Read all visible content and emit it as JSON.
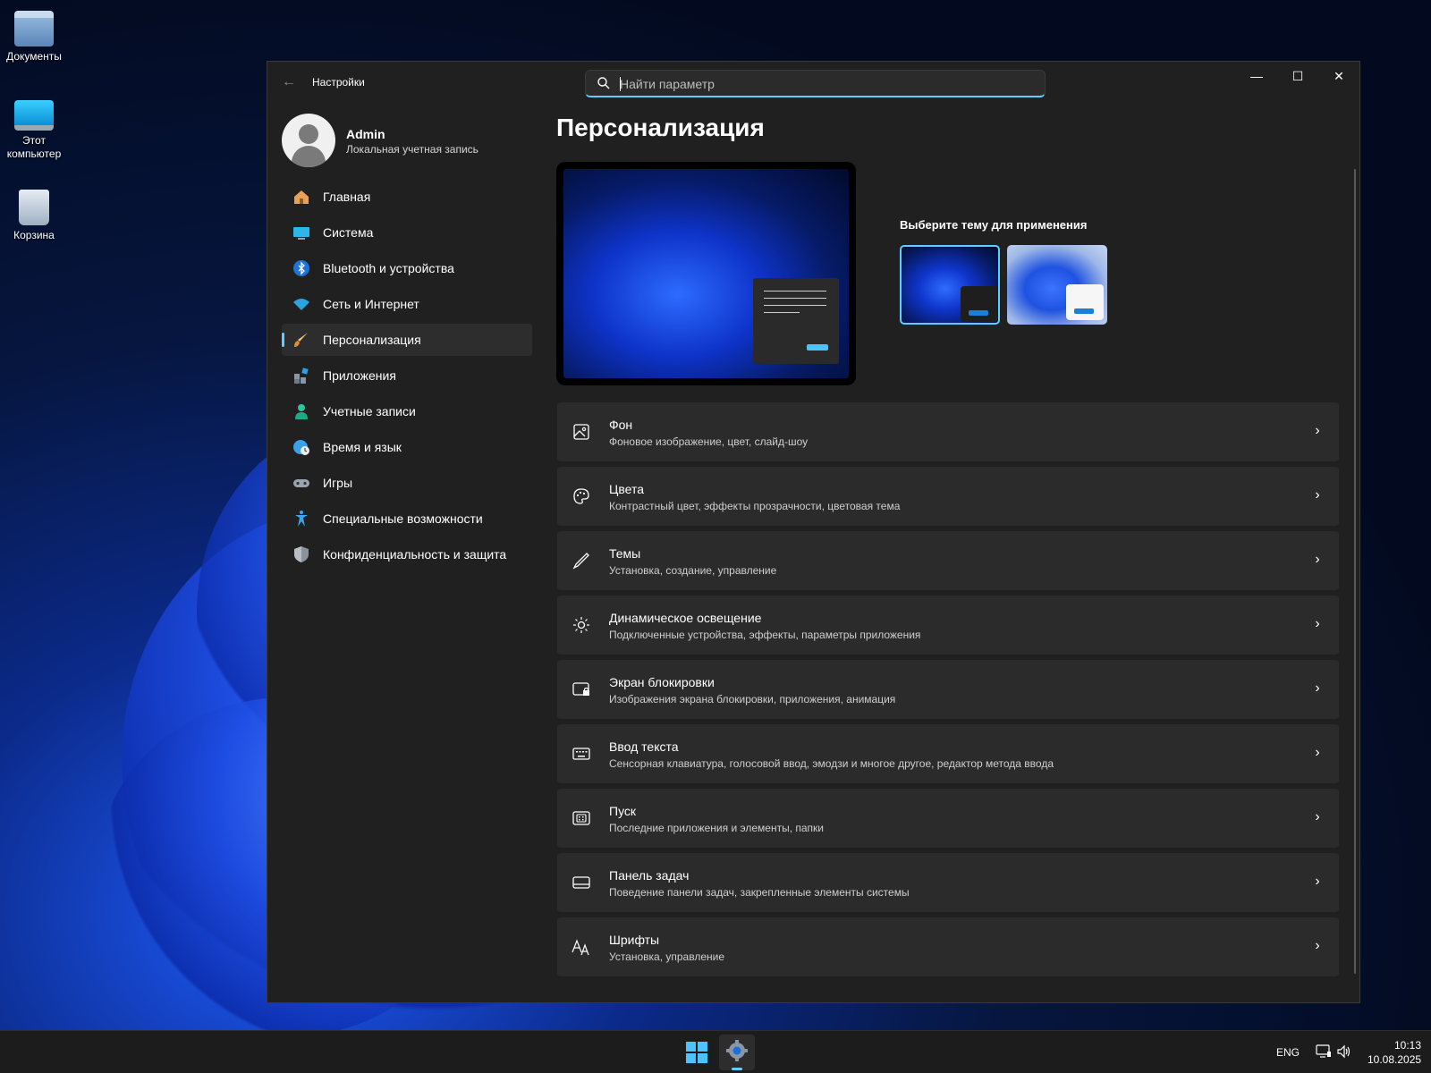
{
  "desktop": {
    "icons": [
      {
        "label": "Документы"
      },
      {
        "label": "Этот компьютер"
      },
      {
        "label": "Корзина"
      }
    ]
  },
  "window": {
    "app_title": "Настройки",
    "search_placeholder": "Найти параметр",
    "controls": {
      "minimize": "—",
      "maximize": "☐",
      "close": "✕"
    }
  },
  "profile": {
    "name": "Admin",
    "subtitle": "Локальная учетная запись"
  },
  "sidebar": {
    "items": [
      {
        "label": "Главная",
        "icon": "home-icon"
      },
      {
        "label": "Система",
        "icon": "monitor-icon"
      },
      {
        "label": "Bluetooth и устройства",
        "icon": "bluetooth-icon"
      },
      {
        "label": "Сеть и Интернет",
        "icon": "wifi-icon"
      },
      {
        "label": "Персонализация",
        "icon": "brush-icon",
        "active": true
      },
      {
        "label": "Приложения",
        "icon": "apps-icon"
      },
      {
        "label": "Учетные записи",
        "icon": "person-icon"
      },
      {
        "label": "Время и язык",
        "icon": "globe-clock-icon"
      },
      {
        "label": "Игры",
        "icon": "gamepad-icon"
      },
      {
        "label": "Специальные возможности",
        "icon": "accessibility-icon"
      },
      {
        "label": "Конфиденциальность и защита",
        "icon": "shield-icon"
      }
    ]
  },
  "main": {
    "page_title": "Персонализация",
    "theme_label": "Выберите тему для применения",
    "cards": [
      {
        "title": "Фон",
        "subtitle": "Фоновое изображение, цвет, слайд-шоу",
        "icon": "picture-icon"
      },
      {
        "title": "Цвета",
        "subtitle": "Контрастный цвет, эффекты прозрачности, цветовая тема",
        "icon": "palette-icon"
      },
      {
        "title": "Темы",
        "subtitle": "Установка, создание, управление",
        "icon": "pen-icon"
      },
      {
        "title": "Динамическое освещение",
        "subtitle": "Подключенные устройства, эффекты, параметры приложения",
        "icon": "light-icon"
      },
      {
        "title": "Экран блокировки",
        "subtitle": "Изображения экрана блокировки, приложения, анимация",
        "icon": "lock-screen-icon"
      },
      {
        "title": "Ввод текста",
        "subtitle": "Сенсорная клавиатура, голосовой ввод, эмодзи и многое другое, редактор метода ввода",
        "icon": "keyboard-icon"
      },
      {
        "title": "Пуск",
        "subtitle": "Последние приложения и элементы, папки",
        "icon": "start-icon"
      },
      {
        "title": "Панель задач",
        "subtitle": "Поведение панели задач, закрепленные элементы системы",
        "icon": "taskbar-icon"
      },
      {
        "title": "Шрифты",
        "subtitle": "Установка, управление",
        "icon": "fonts-icon"
      }
    ]
  },
  "taskbar": {
    "language": "ENG",
    "time": "10:13",
    "date": "10.08.2025"
  },
  "colors": {
    "accent": "#60cdff",
    "window_bg": "#202020",
    "card_bg": "#2b2b2b"
  }
}
